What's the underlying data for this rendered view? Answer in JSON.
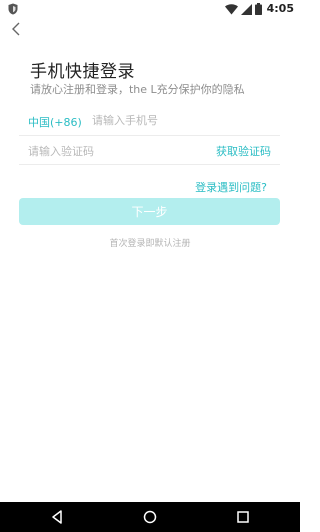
{
  "status_bar": {
    "time": "4:05",
    "icons": [
      "shield-icon",
      "wifi-icon",
      "signal-icon",
      "battery-icon"
    ]
  },
  "header": {
    "back_icon": "chevron-left-icon",
    "title": "手机快捷登录",
    "subtitle": "请放心注册和登录，the L充分保护你的隐私"
  },
  "form": {
    "country_code": "中国(+86)",
    "phone_placeholder": "请输入手机号",
    "code_placeholder": "请输入验证码",
    "get_code_label": "获取验证码"
  },
  "problem_link": "登录遇到问题?",
  "next_button": "下一步",
  "notice": "首次登录即默认注册",
  "nav_bar": {
    "icons": [
      "back-triangle-icon",
      "home-circle-icon",
      "recents-square-icon"
    ]
  },
  "colors": {
    "accent": "#2bbdc4",
    "button_disabled": "#b3eeee",
    "hint_text": "#b8b8b8"
  }
}
